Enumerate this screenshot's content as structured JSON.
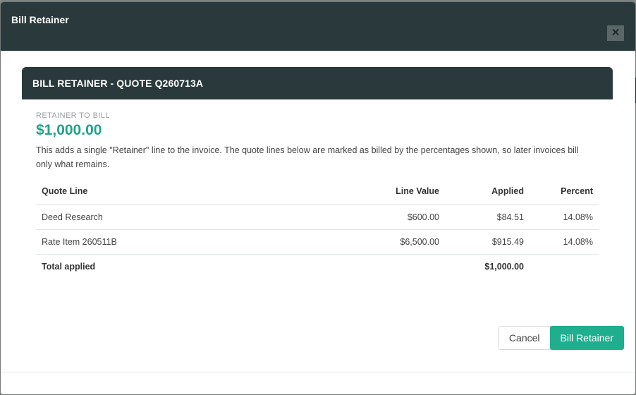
{
  "modal": {
    "title": "Bill Retainer",
    "close_symbol": "✕"
  },
  "card": {
    "title": "BILL RETAINER - QUOTE Q260713A",
    "retainer_label": "RETAINER TO BILL",
    "retainer_amount": "$1,000.00",
    "description": "This adds a single \"Retainer\" line to the invoice. The quote lines below are marked as billed by the percentages shown, so later invoices bill only what remains."
  },
  "table": {
    "headers": [
      "Quote Line",
      "Line Value",
      "Applied",
      "Percent"
    ],
    "rows": [
      {
        "line": "Deed Research",
        "value": "$600.00",
        "applied": "$84.51",
        "percent": "14.08%"
      },
      {
        "line": "Rate Item 260511B",
        "value": "$6,500.00",
        "applied": "$915.49",
        "percent": "14.08%"
      }
    ],
    "total": {
      "label": "Total applied",
      "applied": "$1,000.00"
    }
  },
  "actions": {
    "cancel_label": "Cancel",
    "bill_label": "Bill Retainer"
  },
  "colors": {
    "header_bg": "#2a3a3c",
    "accent": "#1fae8e",
    "amount": "#1fa58a"
  },
  "icons": {
    "close": "close-icon"
  }
}
